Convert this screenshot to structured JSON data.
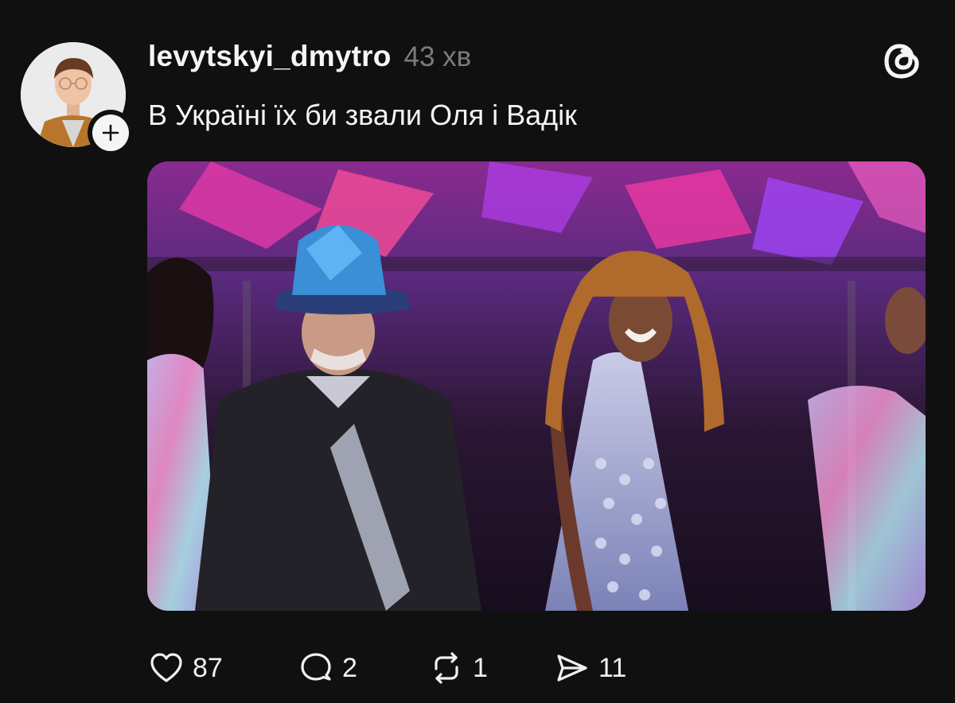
{
  "post": {
    "username": "levytskyi_dmytro",
    "time": "43 хв",
    "text": "В Україні їх би звали Оля і Вадік",
    "image_alt": "",
    "actions": {
      "like": {
        "icon": "heart-icon",
        "count": "87"
      },
      "reply": {
        "icon": "speech-bubble-icon",
        "count": "2"
      },
      "repost": {
        "icon": "repost-arrows-icon",
        "count": "1"
      },
      "share": {
        "icon": "send-arrow-icon",
        "count": "11"
      }
    }
  },
  "colors": {
    "background": "#101010",
    "primary_text": "#f5f5f5",
    "secondary_text": "#7b7b7b",
    "icon": "#f0f0f0"
  }
}
